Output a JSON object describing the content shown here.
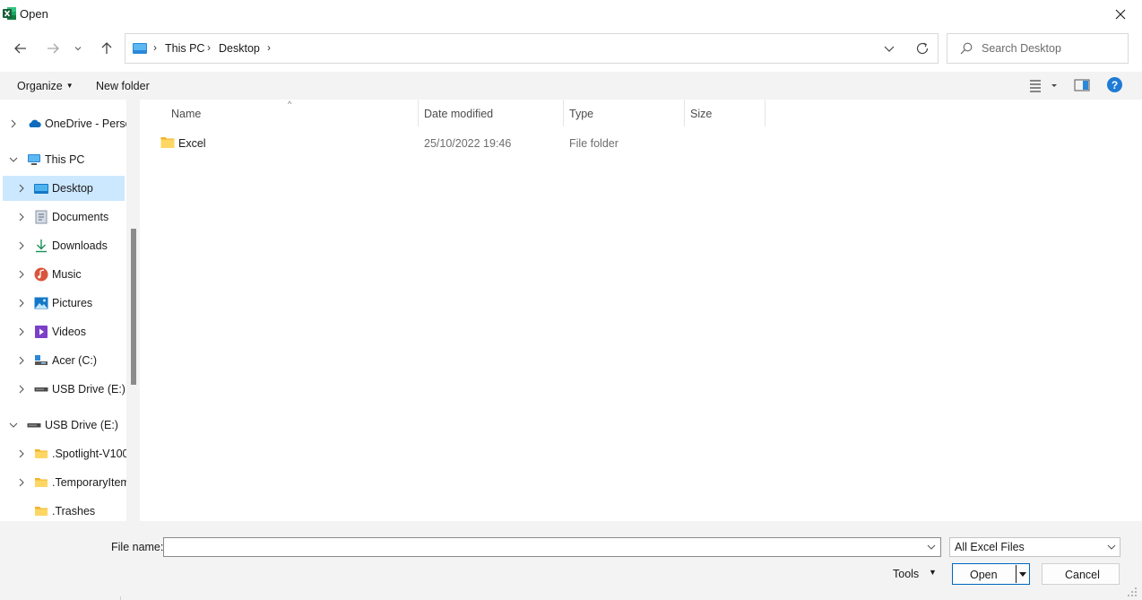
{
  "window": {
    "title": "Open",
    "app_icon": "excel-icon",
    "close_icon": "close-icon"
  },
  "nav": {
    "back_icon": "arrow-left-icon",
    "forward_icon": "arrow-right-icon",
    "recent_icon": "chevron-down-icon",
    "up_icon": "arrow-up-icon"
  },
  "address": {
    "crumbs": [
      "This PC",
      "Desktop"
    ],
    "refresh_icon": "refresh-icon"
  },
  "search": {
    "placeholder": "Search Desktop"
  },
  "toolbar": {
    "organize_label": "Organize",
    "new_folder_label": "New folder",
    "view_icon": "view-list-icon",
    "preview_icon": "preview-pane-icon",
    "help_label": "?"
  },
  "sidebar": {
    "items": [
      {
        "label": "OneDrive - Perso",
        "icon": "cloud-icon",
        "expanded": false
      },
      {
        "label": "This PC",
        "icon": "computer-icon",
        "expanded": true
      },
      {
        "label": "Desktop",
        "icon": "desktop-icon",
        "selected": true
      },
      {
        "label": "Documents",
        "icon": "documents-icon"
      },
      {
        "label": "Downloads",
        "icon": "download-icon"
      },
      {
        "label": "Music",
        "icon": "music-icon"
      },
      {
        "label": "Pictures",
        "icon": "pictures-icon"
      },
      {
        "label": "Videos",
        "icon": "videos-icon"
      },
      {
        "label": "Acer (C:)",
        "icon": "drive-icon"
      },
      {
        "label": "USB Drive (E:)",
        "icon": "usb-drive-icon"
      },
      {
        "label": "USB Drive (E:)",
        "icon": "usb-drive-icon",
        "expanded": true
      },
      {
        "label": ".Spotlight-V100",
        "icon": "folder-icon"
      },
      {
        "label": ".TemporaryItems",
        "icon": "folder-icon"
      },
      {
        "label": ".Trashes",
        "icon": "folder-icon"
      }
    ]
  },
  "filelist": {
    "columns": [
      "Name",
      "Date modified",
      "Type",
      "Size"
    ],
    "rows": [
      {
        "name": "Excel",
        "date": "25/10/2022 19:46",
        "type": "File folder",
        "size": ""
      }
    ]
  },
  "footer": {
    "file_name_label": "File name:",
    "file_name_value": "",
    "file_type": "All Excel Files",
    "tools_label": "Tools",
    "open_label": "Open",
    "cancel_label": "Cancel"
  },
  "colors": {
    "selection": "#cce8ff",
    "accent": "#0067c0",
    "folder": "#f7c548",
    "excel_green": "#1d6f42"
  }
}
